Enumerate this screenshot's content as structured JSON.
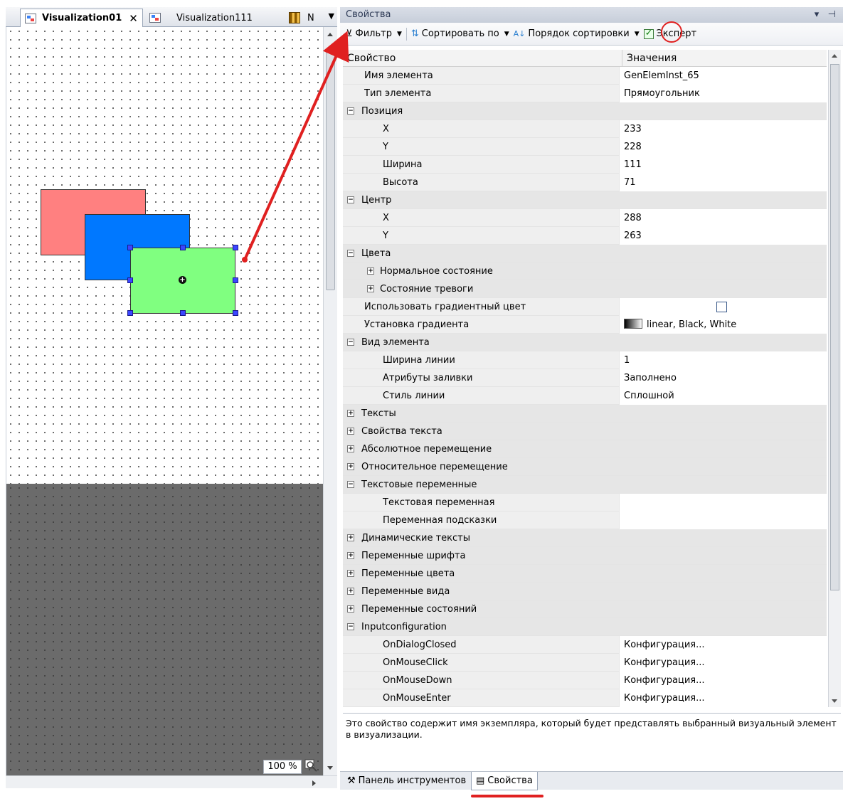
{
  "editor": {
    "tabs": [
      {
        "label": "Visualization01",
        "close": "✕"
      },
      {
        "label": "Visualization111"
      },
      {
        "label": "N"
      }
    ],
    "zoom": "100 %"
  },
  "properties": {
    "title": "Свойства",
    "toolbar": {
      "filter": "Фильтр",
      "sort_by": "Сортировать по",
      "sort_order": "Порядок сортировки",
      "expert": "Эксперт",
      "expert_checked": true
    },
    "columns": {
      "property": "Свойство",
      "value": "Значения"
    },
    "rows": [
      {
        "name": "Имя элемента",
        "value": "GenElemInst_65",
        "type": "prop",
        "level": 0
      },
      {
        "name": "Тип элемента",
        "value": "Прямоугольник",
        "type": "prop",
        "level": 0
      },
      {
        "name": "Позиция",
        "value": "",
        "type": "group",
        "expanded": true
      },
      {
        "name": "X",
        "value": "233",
        "type": "prop",
        "level": 1
      },
      {
        "name": "Y",
        "value": "228",
        "type": "prop",
        "level": 1
      },
      {
        "name": "Ширина",
        "value": "111",
        "type": "prop",
        "level": 1
      },
      {
        "name": "Высота",
        "value": "71",
        "type": "prop",
        "level": 1
      },
      {
        "name": "Центр",
        "value": "",
        "type": "group",
        "expanded": true
      },
      {
        "name": "X",
        "value": "288",
        "type": "prop",
        "level": 1
      },
      {
        "name": "Y",
        "value": "263",
        "type": "prop",
        "level": 1
      },
      {
        "name": "Цвета",
        "value": "",
        "type": "group",
        "expanded": true
      },
      {
        "name": "Нормальное состояние",
        "value": "",
        "type": "subgroup",
        "expanded": false
      },
      {
        "name": "Состояние тревоги",
        "value": "",
        "type": "subgroup",
        "expanded": false
      },
      {
        "name": "Использовать градиентный цвет",
        "value": "",
        "type": "check",
        "level": 0,
        "checked": false
      },
      {
        "name": "Установка градиента",
        "value": "linear, Black, White",
        "type": "gradient",
        "level": 0
      },
      {
        "name": "Вид элемента",
        "value": "",
        "type": "group",
        "expanded": true
      },
      {
        "name": "Ширина линии",
        "value": "1",
        "type": "prop",
        "level": 1
      },
      {
        "name": "Атрибуты заливки",
        "value": "Заполнено",
        "type": "prop",
        "level": 1
      },
      {
        "name": "Стиль линии",
        "value": "Сплошной",
        "type": "prop",
        "level": 1
      },
      {
        "name": "Тексты",
        "value": "",
        "type": "group",
        "expanded": false
      },
      {
        "name": "Свойства текста",
        "value": "",
        "type": "group",
        "expanded": false
      },
      {
        "name": "Абсолютное перемещение",
        "value": "",
        "type": "group",
        "expanded": false
      },
      {
        "name": "Относительное перемещение",
        "value": "",
        "type": "group",
        "expanded": false
      },
      {
        "name": "Текстовые переменные",
        "value": "",
        "type": "group",
        "expanded": true
      },
      {
        "name": "Текстовая переменная",
        "value": "",
        "type": "prop",
        "level": 1
      },
      {
        "name": "Переменная подсказки",
        "value": "",
        "type": "prop",
        "level": 1
      },
      {
        "name": "Динамические тексты",
        "value": "",
        "type": "group",
        "expanded": false
      },
      {
        "name": "Переменные шрифта",
        "value": "",
        "type": "group",
        "expanded": false
      },
      {
        "name": "Переменные цвета",
        "value": "",
        "type": "group",
        "expanded": false
      },
      {
        "name": "Переменные вида",
        "value": "",
        "type": "group",
        "expanded": false
      },
      {
        "name": "Переменные состояний",
        "value": "",
        "type": "group",
        "expanded": false
      },
      {
        "name": "Inputconfiguration",
        "value": "",
        "type": "group",
        "expanded": true
      },
      {
        "name": "OnDialogClosed",
        "value": "Конфигурация...",
        "type": "prop",
        "level": 1
      },
      {
        "name": "OnMouseClick",
        "value": "Конфигурация...",
        "type": "prop",
        "level": 1
      },
      {
        "name": "OnMouseDown",
        "value": "Конфигурация...",
        "type": "prop",
        "level": 1
      },
      {
        "name": "OnMouseEnter",
        "value": "Конфигурация...",
        "type": "prop",
        "level": 1
      }
    ],
    "description": "Это свойство содержит имя экземпляра, который будет представлять выбранный визуальный элемент в визуализации.",
    "bottom_tabs": [
      "Панель инструментов",
      "Свойства"
    ]
  },
  "colors": {
    "rect_red": "#ff8080",
    "rect_blue": "#0078ff",
    "rect_green": "#80ff80",
    "annotation": "#e02020"
  }
}
